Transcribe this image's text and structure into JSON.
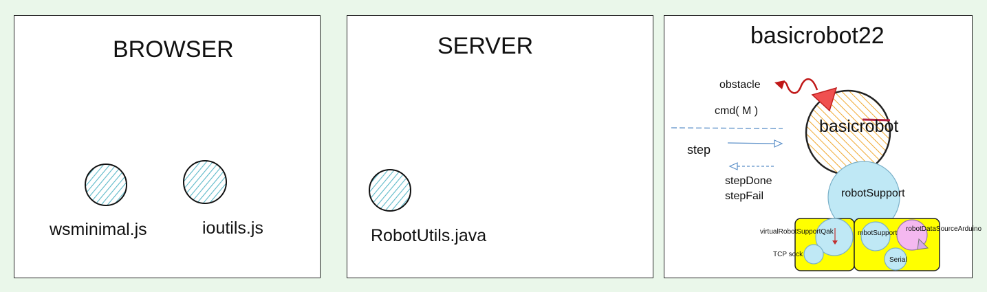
{
  "browser": {
    "title": "BROWSER",
    "components": [
      "wsminimal.js",
      "ioutils.js"
    ]
  },
  "server": {
    "title": "SERVER",
    "components": [
      "RobotUtils.java"
    ]
  },
  "robot": {
    "title": "basicrobot22",
    "robot_label": "basicrobot",
    "messages": {
      "obstacle": "obstacle",
      "cmd": "cmd( M )",
      "step": "step",
      "step_done": "stepDone",
      "step_fail": "stepFail"
    },
    "support": {
      "main": "robotSupport",
      "virtual": "virtualRobotSupportQak",
      "tcp": "TCP sock",
      "mbot": "mbotSupport",
      "datasource": "robotDataSourceArduino",
      "serial": "Serial"
    }
  },
  "colors": {
    "background": "#eaf7ea",
    "hatch": "#5bb8c8",
    "orange_hatch": "#f0a830",
    "red": "#e84040",
    "yellow": "#ffff00",
    "light_blue": "#bfe8f5",
    "pink": "#f4b8f0",
    "arrow_blue": "#5a8fc8"
  }
}
